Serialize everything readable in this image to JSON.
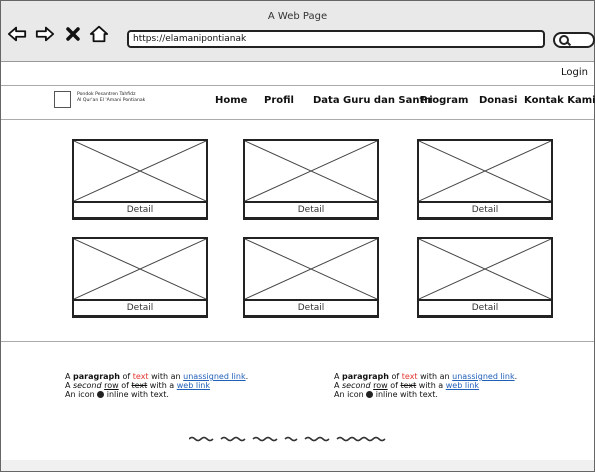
{
  "window": {
    "title": "A Web Page",
    "url": "https://elamanipontianak"
  },
  "nav": {
    "back": "back-arrow",
    "forward": "forward-arrow",
    "close": "close-x",
    "home": "home"
  },
  "top": {
    "login": "Login"
  },
  "header": {
    "brand_line1": "Pondok Pesantren Tahfidz",
    "brand_line2": "Al Qur'an El 'Amani Pontianak",
    "menu": [
      "Home",
      "Profil",
      "Data Guru dan Santri",
      "Program",
      "Donasi",
      "Kontak Kami"
    ]
  },
  "cards": [
    {
      "detail": "Detail"
    },
    {
      "detail": "Detail"
    },
    {
      "detail": "Detail"
    },
    {
      "detail": "Detail"
    },
    {
      "detail": "Detail"
    },
    {
      "detail": "Detail"
    }
  ],
  "footer": {
    "col1": {
      "l1_a": "A ",
      "l1_b": "paragraph",
      "l1_c": " of ",
      "l1_d": "text",
      "l1_e": " with an ",
      "l1_f": "unassigned link",
      "l1_g": ".",
      "l2_a": "A ",
      "l2_b": "second",
      "l2_c": " ",
      "l2_d": "row",
      "l2_e": " of ",
      "l2_f": "text",
      "l2_g": " with a ",
      "l2_h": "web link",
      "l3_a": "An icon ",
      "l3_b": " inline with text."
    },
    "col2": {
      "l1_a": "A ",
      "l1_b": "paragraph",
      "l1_c": " of ",
      "l1_d": "text",
      "l1_e": " with an ",
      "l1_f": "unassigned link",
      "l1_g": ".",
      "l2_a": "A ",
      "l2_b": "second",
      "l2_c": " ",
      "l2_d": "row",
      "l2_e": " of ",
      "l2_f": "text",
      "l2_g": " with a ",
      "l2_h": "web link",
      "l3_a": "An icon ",
      "l3_b": " inline with text."
    }
  },
  "colors": {
    "link": "#1f5fb8",
    "accent_red": "#e2342b",
    "chrome": "#e9e9e9"
  }
}
